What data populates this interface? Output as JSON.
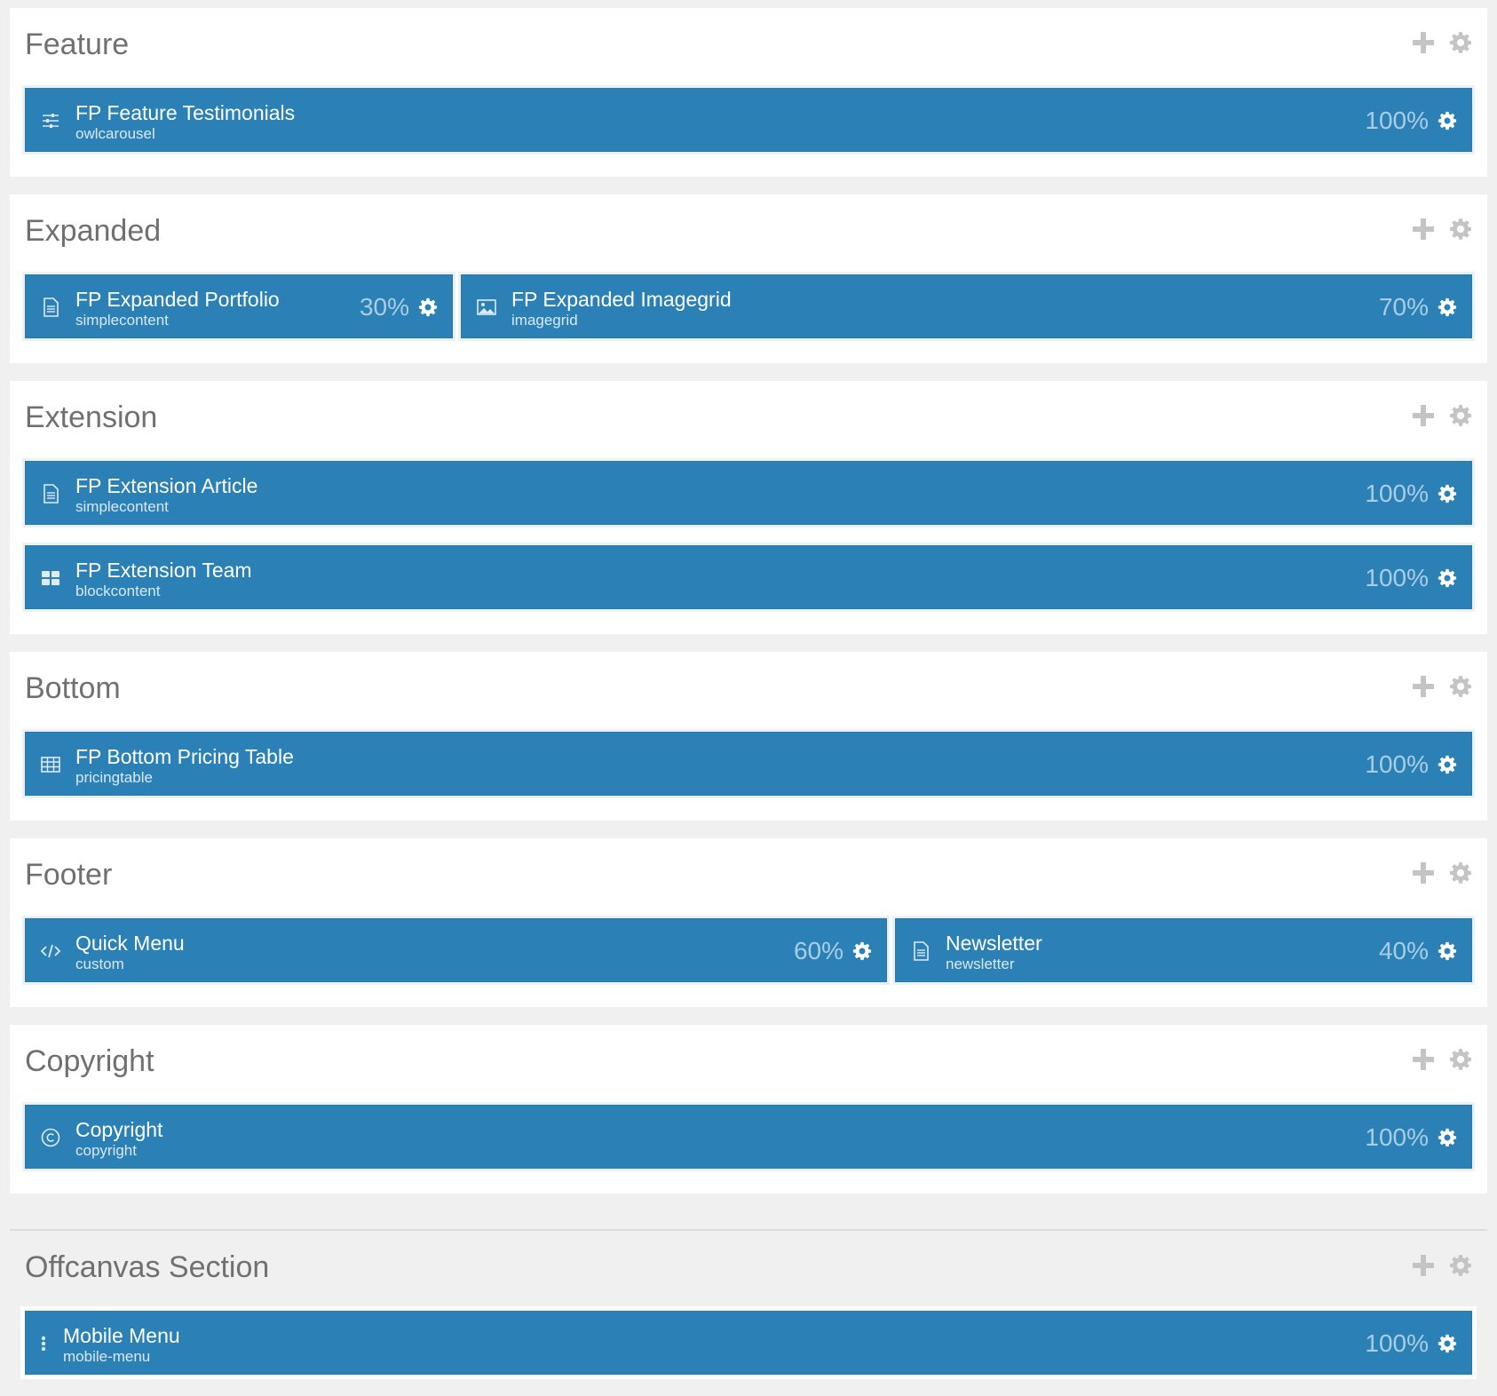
{
  "sections": [
    {
      "title": "Feature",
      "modules": [
        {
          "title": "FP Feature Testimonials",
          "type": "owlcarousel",
          "width": "100%",
          "icon": "sliders-icon"
        }
      ]
    },
    {
      "title": "Expanded",
      "modules": [
        {
          "title": "FP Expanded Portfolio",
          "type": "simplecontent",
          "width": "30%",
          "icon": "document-icon"
        },
        {
          "title": "FP Expanded Imagegrid",
          "type": "imagegrid",
          "width": "70%",
          "icon": "image-icon"
        }
      ]
    },
    {
      "title": "Extension",
      "modules": [
        {
          "title": "FP Extension Article",
          "type": "simplecontent",
          "width": "100%",
          "icon": "document-icon"
        },
        {
          "title": "FP Extension Team",
          "type": "blockcontent",
          "width": "100%",
          "icon": "grid-icon"
        }
      ]
    },
    {
      "title": "Bottom",
      "modules": [
        {
          "title": "FP Bottom Pricing Table",
          "type": "pricingtable",
          "width": "100%",
          "icon": "table-icon"
        }
      ]
    },
    {
      "title": "Footer",
      "modules": [
        {
          "title": "Quick Menu",
          "type": "custom",
          "width": "60%",
          "icon": "code-icon"
        },
        {
          "title": "Newsletter",
          "type": "newsletter",
          "width": "40%",
          "icon": "document-icon"
        }
      ]
    },
    {
      "title": "Copyright",
      "modules": [
        {
          "title": "Copyright",
          "type": "copyright",
          "width": "100%",
          "icon": "copyright-icon"
        }
      ]
    },
    {
      "title": "Offcanvas Section",
      "modules": [
        {
          "title": "Mobile Menu",
          "type": "mobile-menu",
          "width": "100%",
          "icon": "dots-vertical-icon"
        }
      ]
    }
  ],
  "colors": {
    "module_bg": "#2b81b6",
    "page_bg": "#f0f0f0",
    "section_bg": "#ffffff",
    "title_text": "#707070",
    "action_icon": "#c4c4c4",
    "percent_text": "#a9cde5"
  }
}
